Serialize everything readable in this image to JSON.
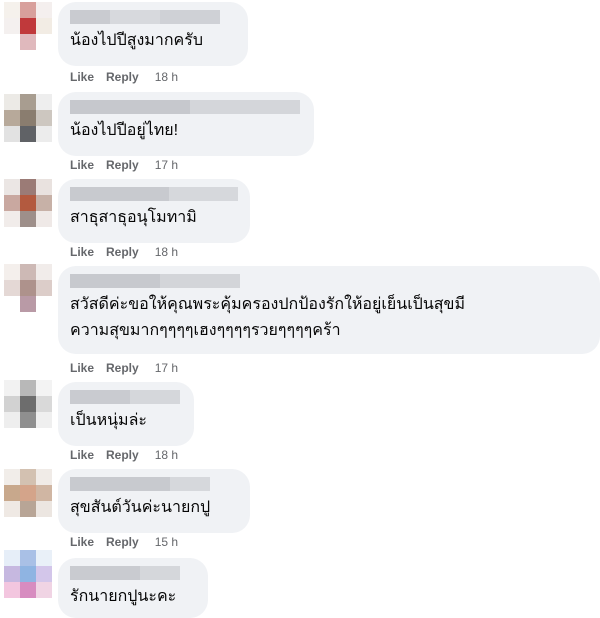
{
  "actions": {
    "like": "Like",
    "reply": "Reply"
  },
  "comments": [
    {
      "text": "น้องไปปีสูงมากครับ",
      "time": "18 h"
    },
    {
      "text": "น้องไปปีอยู่ไทย!",
      "time": "17 h"
    },
    {
      "text": "สาธุสาธุอนุโมทามิ",
      "time": "18 h"
    },
    {
      "text": "สวัสดีค่ะขอให้คุณพระคุ้มครองปกป้องรักให้อยู่เย็นเป็นสุขมี\nความสุขมากๆๆๆๆเฮงๆๆๆๆรวยๆๆๆๆคร้า",
      "time": "17 h"
    },
    {
      "text": "เป็นหนุ่มล่ะ",
      "time": "18 h"
    },
    {
      "text": "สุขสันต์วันค่ะนายกปู",
      "time": "15 h"
    },
    {
      "text": "รักนายกปูนะคะ",
      "time": ""
    }
  ],
  "colors": {
    "bubble": "#f0f2f5",
    "action": "#65676b",
    "text": "#050505"
  }
}
